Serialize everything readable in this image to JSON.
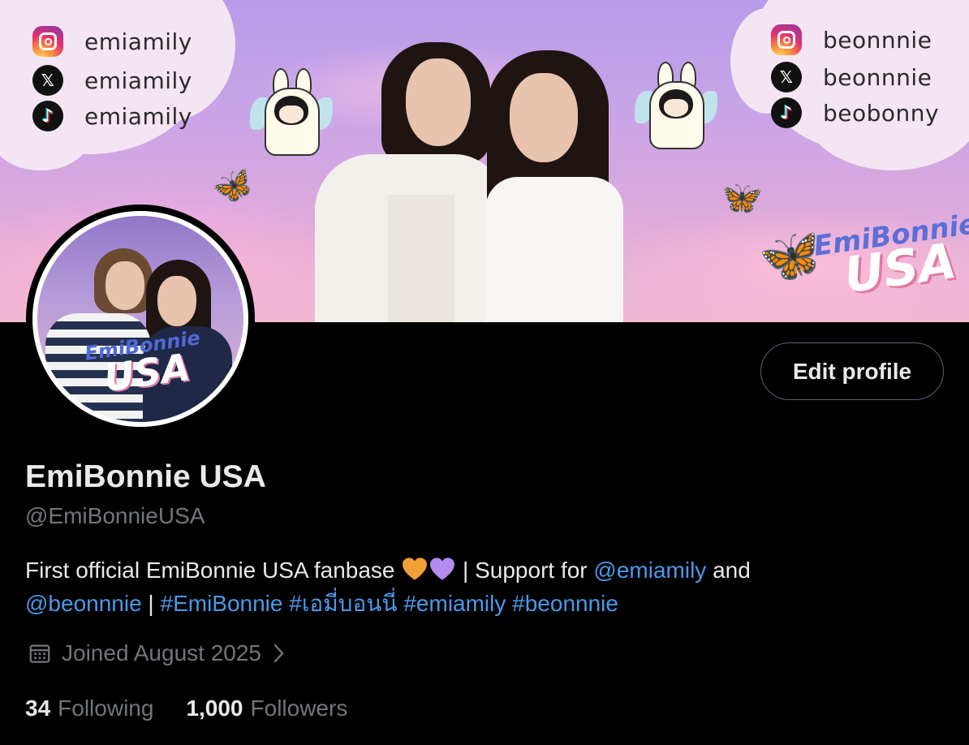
{
  "banner": {
    "left_socials": [
      {
        "icon": "instagram-icon",
        "handle": "emiamily"
      },
      {
        "icon": "x-icon",
        "handle": "emiamily"
      },
      {
        "icon": "tiktok-icon",
        "handle": "emiamily"
      }
    ],
    "right_socials": [
      {
        "icon": "instagram-icon",
        "handle": "beonnnie"
      },
      {
        "icon": "x-icon",
        "handle": "beonnnie"
      },
      {
        "icon": "tiktok-icon",
        "handle": "beobonny"
      }
    ],
    "brand_line1": "EmiBonnie",
    "brand_line2": "USA"
  },
  "avatar": {
    "brand_line1": "EmiBonnie",
    "brand_line2": "USA"
  },
  "profile": {
    "edit_button_label": "Edit profile",
    "display_name": "EmiBonnie USA",
    "handle": "@EmiBonnieUSA",
    "bio": {
      "text1": "First official EmiBonnie USA fanbase",
      "text2": " | Support for ",
      "mention1": "@emiamily",
      "text3": " and ",
      "mention2": "@beonnnie",
      "text4": " | ",
      "hashtags": [
        "#EmiBonnie",
        "#เอมี่บอนนี่",
        "#emiamily",
        "#beonnnie"
      ]
    },
    "joined": "Joined August 2025",
    "following_count": "34",
    "following_label": "Following",
    "followers_count": "1,000",
    "followers_label": "Followers"
  },
  "colors": {
    "background": "#000000",
    "text_primary": "#e7e9ea",
    "text_secondary": "#71767b",
    "link": "#4a99e9",
    "heart_orange": "#f0a036",
    "heart_purple": "#b48cf0"
  }
}
